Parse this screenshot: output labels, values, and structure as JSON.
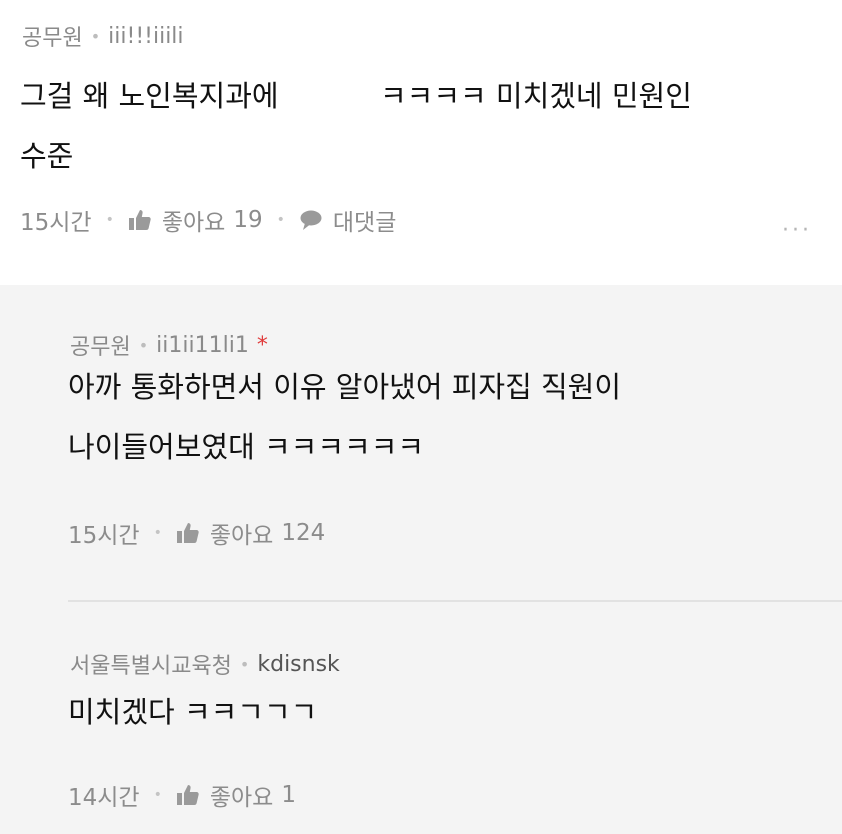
{
  "top_comment": {
    "author": "공무원",
    "nickname": "iii!!!iiili",
    "body_line1": "그걸 왜 노인복지과에           ㅋㅋㅋㅋ 미치겠네 민원인",
    "body_line2": "수준",
    "time": "15시간",
    "like_label": "좋아요",
    "like_count": "19",
    "reply_label": "대댓글",
    "more": "···"
  },
  "replies": [
    {
      "author": "공무원",
      "nickname": "ii1ii11li1",
      "author_marker": "*",
      "body_line1": "아까 통화하면서 이유 알아냈어 피자집 직원이",
      "body_line2": "나이들어보였대 ㅋㅋㅋㅋㅋㅋ",
      "time": "15시간",
      "like_label": "좋아요",
      "like_count": "124"
    },
    {
      "author": "서울특별시교육청",
      "nickname": "kdisnsk",
      "body_line1": "미치겠다 ㅋㅋㄱㄱㄱ",
      "time": "14시간",
      "like_label": "좋아요",
      "like_count": "1"
    }
  ],
  "icons": {
    "like": "thumbs-up-icon",
    "reply": "speech-bubble-icon",
    "more": "ellipsis-icon"
  },
  "colors": {
    "meta_gray": "#8a8a8a",
    "reply_background": "#f4f4f4",
    "marker_red": "#e03a3a"
  }
}
